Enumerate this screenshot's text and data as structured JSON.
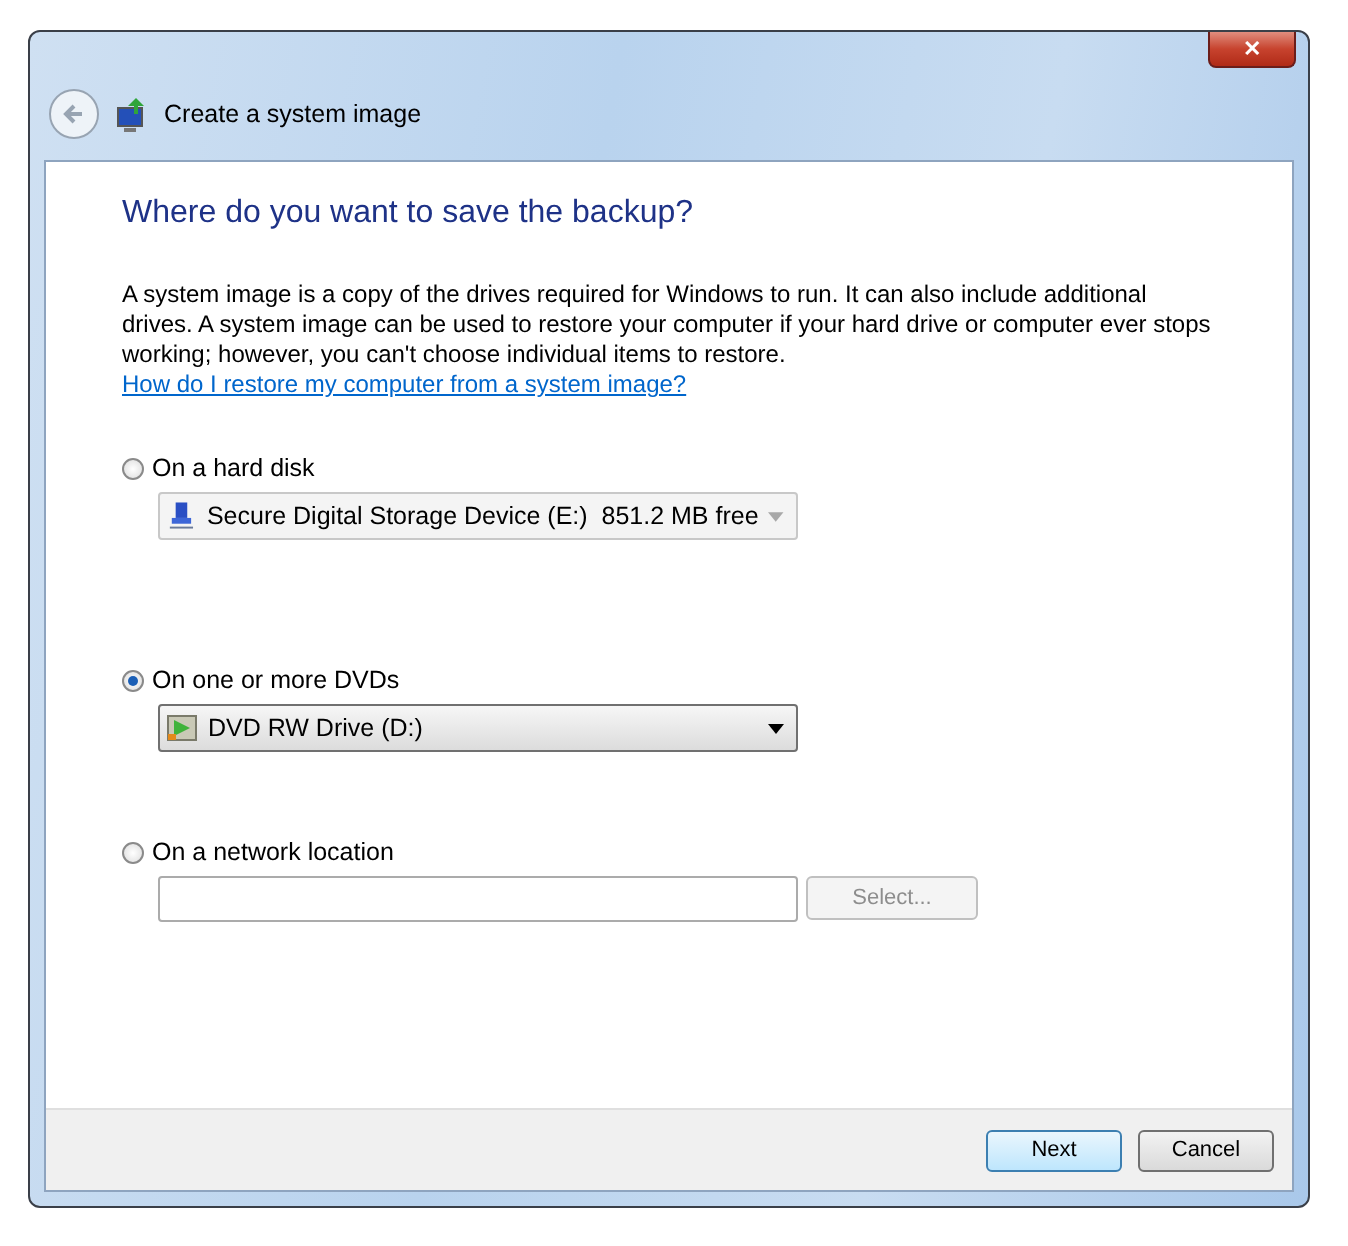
{
  "window": {
    "title": "Create a system image",
    "close_label": "✕"
  },
  "heading": "Where do you want to save the backup?",
  "description": "A system image is a copy of the drives required for Windows to run. It can also include additional drives. A system image can be used to restore your computer if your hard drive or computer ever stops working; however, you can't choose individual items to restore.",
  "help_link": "How do I restore my computer from a system image?",
  "options": [
    {
      "kind": "dropdown",
      "label": "On a hard disk",
      "selected": false,
      "value": "Secure Digital Storage Device (E:)  851.2 MB free",
      "disabled": true
    },
    {
      "kind": "dropdown",
      "label": "On one or more DVDs",
      "selected": true,
      "value": "DVD RW Drive (D:)",
      "disabled": false
    },
    {
      "kind": "field",
      "label": "On a network location",
      "selected": false,
      "button": "Select...",
      "button_disabled": true
    }
  ],
  "buttons": [
    {
      "label": "Next",
      "default": true
    },
    {
      "label": "Cancel",
      "default": false
    }
  ]
}
